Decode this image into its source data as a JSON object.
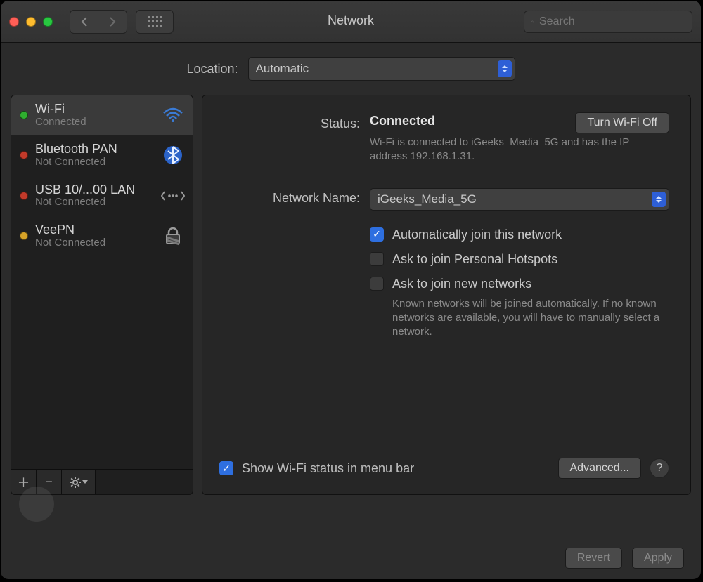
{
  "window": {
    "title": "Network"
  },
  "toolbar": {
    "search_placeholder": "Search"
  },
  "location": {
    "label": "Location:",
    "value": "Automatic"
  },
  "sidebar": {
    "services": [
      {
        "name": "Wi-Fi",
        "status": "Connected",
        "dot": "green",
        "icon": "wifi",
        "selected": true
      },
      {
        "name": "Bluetooth PAN",
        "status": "Not Connected",
        "dot": "red",
        "icon": "bluetooth",
        "selected": false
      },
      {
        "name": "USB 10/...00 LAN",
        "status": "Not Connected",
        "dot": "red",
        "icon": "ethernet",
        "selected": false
      },
      {
        "name": "VeePN",
        "status": "Not Connected",
        "dot": "yellow",
        "icon": "lock",
        "selected": false
      }
    ]
  },
  "details": {
    "status_label": "Status:",
    "status_value": "Connected",
    "wifi_off_label": "Turn Wi-Fi Off",
    "status_hint": "Wi-Fi is connected to iGeeks_Media_5G and has the IP address 192.168.1.31.",
    "network_name_label": "Network Name:",
    "network_name_value": "iGeeks_Media_5G",
    "auto_join_label": "Automatically join this network",
    "ask_hotspot_label": "Ask to join Personal Hotspots",
    "ask_networks_label": "Ask to join new networks",
    "ask_networks_hint": "Known networks will be joined automatically. If no known networks are available, you will have to manually select a network.",
    "show_menubar_label": "Show Wi-Fi status in menu bar",
    "advanced_label": "Advanced...",
    "help_label": "?"
  },
  "footer": {
    "revert": "Revert",
    "apply": "Apply"
  }
}
